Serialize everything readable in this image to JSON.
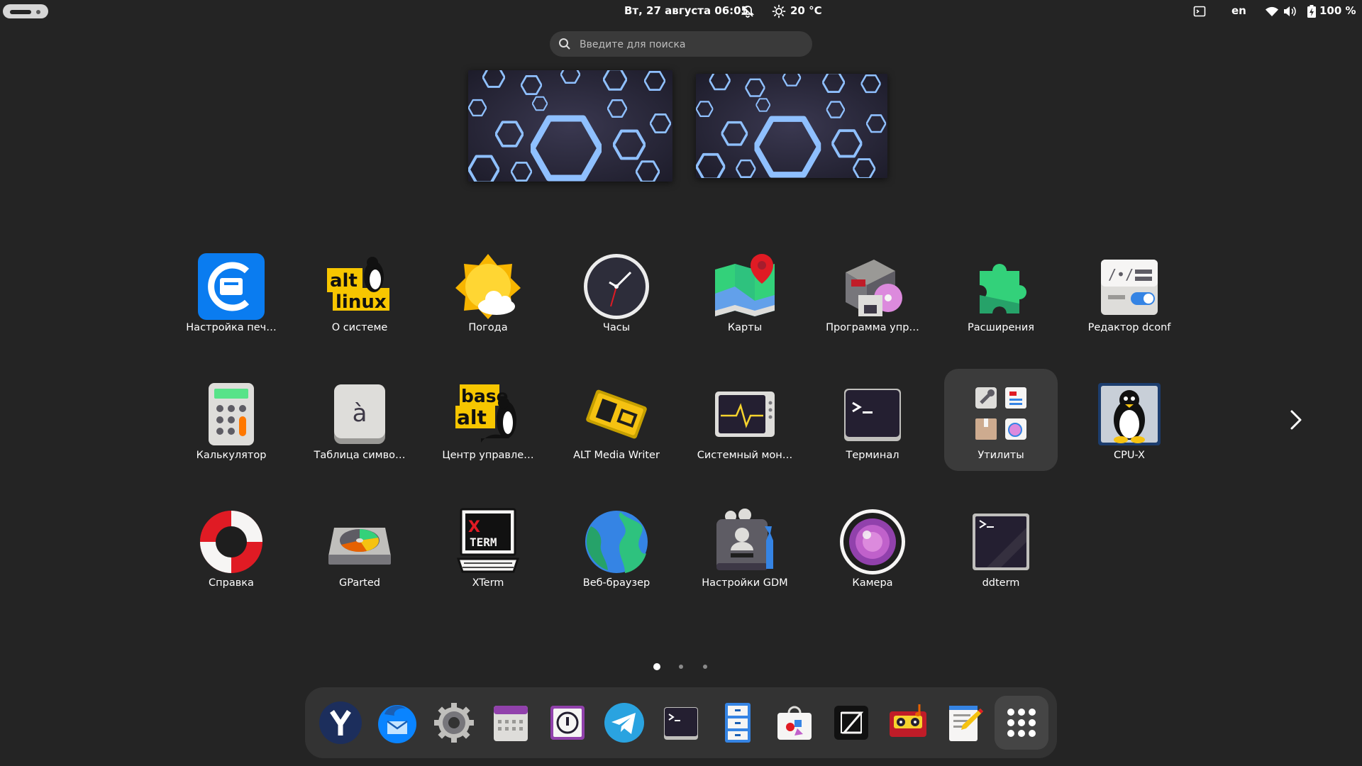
{
  "topbar": {
    "clock": "Вт, 27 августа  06:05",
    "weather_temp": "20 °C",
    "language": "en",
    "battery": "100 %",
    "icons": [
      "activities-indicator",
      "notifications-off-icon",
      "weather-sun-icon",
      "terminal-indicator-icon",
      "wifi-icon",
      "volume-icon",
      "battery-icon"
    ]
  },
  "search": {
    "placeholder": "Введите для поиска"
  },
  "app_grid": {
    "rows": [
      [
        {
          "name": "printer-settings",
          "label": "Настройка печ…",
          "icon": "printer-settings-icon"
        },
        {
          "name": "about-system",
          "label": "О системе",
          "icon": "alt-linux-icon"
        },
        {
          "name": "weather",
          "label": "Погода",
          "icon": "weather-icon"
        },
        {
          "name": "clocks",
          "label": "Часы",
          "icon": "clock-icon"
        },
        {
          "name": "maps",
          "label": "Карты",
          "icon": "maps-icon"
        },
        {
          "name": "package-manager",
          "label": "Программа упр…",
          "icon": "package-manager-icon"
        },
        {
          "name": "extensions",
          "label": "Расширения",
          "icon": "puzzle-icon"
        },
        {
          "name": "dconf-editor",
          "label": "Редактор dconf",
          "icon": "dconf-icon"
        }
      ],
      [
        {
          "name": "calculator",
          "label": "Калькулятор",
          "icon": "calculator-icon"
        },
        {
          "name": "character-map",
          "label": "Таблица симво…",
          "icon": "character-map-icon"
        },
        {
          "name": "control-center",
          "label": "Центр управле…",
          "icon": "basealt-icon"
        },
        {
          "name": "alt-media-writer",
          "label": "ALT Media Writer",
          "icon": "media-writer-icon"
        },
        {
          "name": "system-monitor",
          "label": "Системный мон…",
          "icon": "system-monitor-icon"
        },
        {
          "name": "terminal",
          "label": "Терминал",
          "icon": "terminal-icon"
        },
        {
          "name": "utilities-folder",
          "label": "Утилиты",
          "icon": "folder-icon",
          "folder": true
        },
        {
          "name": "cpu-x",
          "label": "CPU-X",
          "icon": "tux-icon"
        }
      ],
      [
        {
          "name": "help",
          "label": "Справка",
          "icon": "lifebuoy-icon"
        },
        {
          "name": "gparted",
          "label": "GParted",
          "icon": "gparted-icon"
        },
        {
          "name": "xterm",
          "label": "XTerm",
          "icon": "xterm-icon"
        },
        {
          "name": "web-browser",
          "label": "Веб-браузер",
          "icon": "globe-icon"
        },
        {
          "name": "gdm-settings",
          "label": "Настройки GDM",
          "icon": "gdm-settings-icon"
        },
        {
          "name": "camera",
          "label": "Камера",
          "icon": "camera-icon"
        },
        {
          "name": "ddterm",
          "label": "ddterm",
          "icon": "ddterm-icon"
        }
      ]
    ],
    "xterm_icon_text": {
      "x": "X",
      "term": "TERM"
    },
    "basealt_icon_text": {
      "line1": "base",
      "line2": "alt"
    },
    "altlinux_icon_text": {
      "line1": "alt",
      "line2": "linux"
    },
    "char_map_glyph": "à"
  },
  "pagination": {
    "pages": 3,
    "current": 1
  },
  "dock": {
    "items": [
      {
        "name": "yandex-browser",
        "icon": "yandex-browser-icon"
      },
      {
        "name": "thunderbird",
        "icon": "thunderbird-icon"
      },
      {
        "name": "settings",
        "icon": "gear-icon"
      },
      {
        "name": "calendar",
        "icon": "calendar-icon"
      },
      {
        "name": "password-manager",
        "icon": "password-manager-icon"
      },
      {
        "name": "telegram",
        "icon": "telegram-icon"
      },
      {
        "name": "terminal",
        "icon": "terminal-icon"
      },
      {
        "name": "file-cabinet",
        "icon": "file-cabinet-icon"
      },
      {
        "name": "software-store",
        "icon": "software-store-icon"
      },
      {
        "name": "zed-editor",
        "icon": "zed-editor-icon"
      },
      {
        "name": "audio-recorder",
        "icon": "cassette-icon"
      },
      {
        "name": "text-editor",
        "icon": "text-editor-icon"
      },
      {
        "name": "show-apps",
        "icon": "app-grid-icon",
        "active": true
      }
    ]
  },
  "colors": {
    "background": "#242424",
    "accent": "#3584e4",
    "folder_bg": "#3b3b3b",
    "dock_bg": "#333333"
  }
}
